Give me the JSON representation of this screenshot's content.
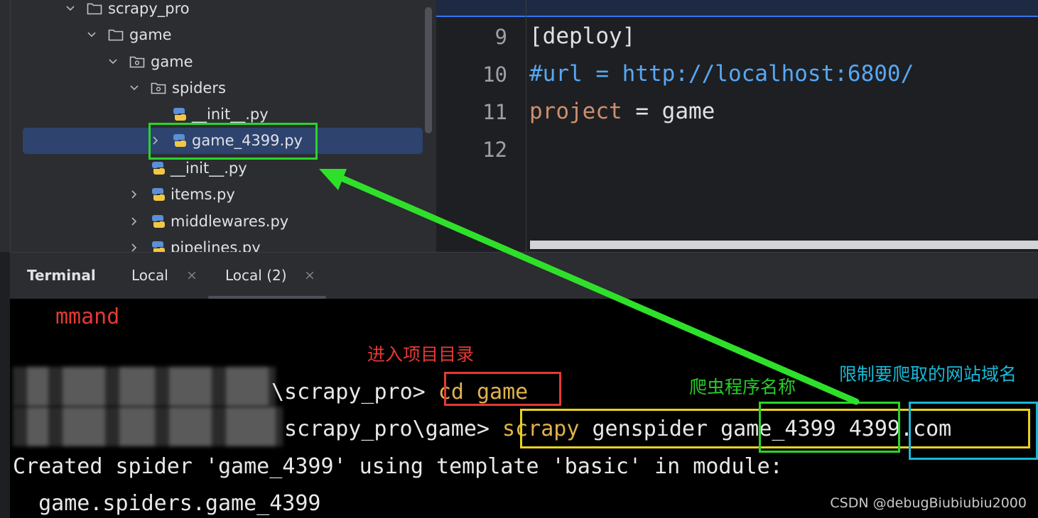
{
  "project_tree": {
    "items": [
      {
        "label": "scrapy_pro",
        "kind": "folder",
        "expanded": true
      },
      {
        "label": "game",
        "kind": "folder",
        "expanded": true
      },
      {
        "label": "game",
        "kind": "package",
        "expanded": true
      },
      {
        "label": "spiders",
        "kind": "package",
        "expanded": true
      },
      {
        "label": "__init__.py",
        "kind": "python"
      },
      {
        "label": "game_4399.py",
        "kind": "python",
        "selected": true
      },
      {
        "label": "__init__.py",
        "kind": "python"
      },
      {
        "label": "items.py",
        "kind": "python"
      },
      {
        "label": "middlewares.py",
        "kind": "python"
      },
      {
        "label": "pipelines.py",
        "kind": "python"
      }
    ]
  },
  "editor": {
    "line_numbers": [
      "9",
      "10",
      "11",
      "12"
    ],
    "lines": {
      "l9": "[deploy]",
      "l10": "#url = http://localhost:6800/",
      "l11_key": "project",
      "l11_eq": " = ",
      "l11_val": "game",
      "l12": ""
    }
  },
  "terminal": {
    "title": "Terminal",
    "tabs": [
      "Local",
      "Local (2)"
    ],
    "active_tab": "Local (2)",
    "close_icon": "×",
    "lines": {
      "partial": "mmand",
      "prompt1": "\\scrapy_pro> ",
      "cmd1": "cd game",
      "prompt2": "scrapy_pro\\game> ",
      "cmd2_a": "scrapy",
      "cmd2_b": " genspider ",
      "cmd2_c": "game_4399",
      "cmd2_d": " 4399.com",
      "out1": "Created spider 'game_4399' using template 'basic' in module:",
      "out2": "  game.spiders.game_4399"
    }
  },
  "annotations": {
    "enter_dir": "进入项目目录",
    "spider_name": "爬虫程序名称",
    "domain_limit": "限制要爬取的网站域名"
  },
  "watermark": "CSDN @debugBiubiubiu2000",
  "colors": {
    "annotation_red": "#e53935",
    "annotation_green": "#29cc29",
    "annotation_cyan": "#19b8d6",
    "box_yellow": "#e8d21d",
    "arrow_green": "#2fe02a",
    "scrapy_orange": "#e0b24c",
    "keyword_orange": "#cf8e6d",
    "comment_blue": "#56a8f5"
  }
}
